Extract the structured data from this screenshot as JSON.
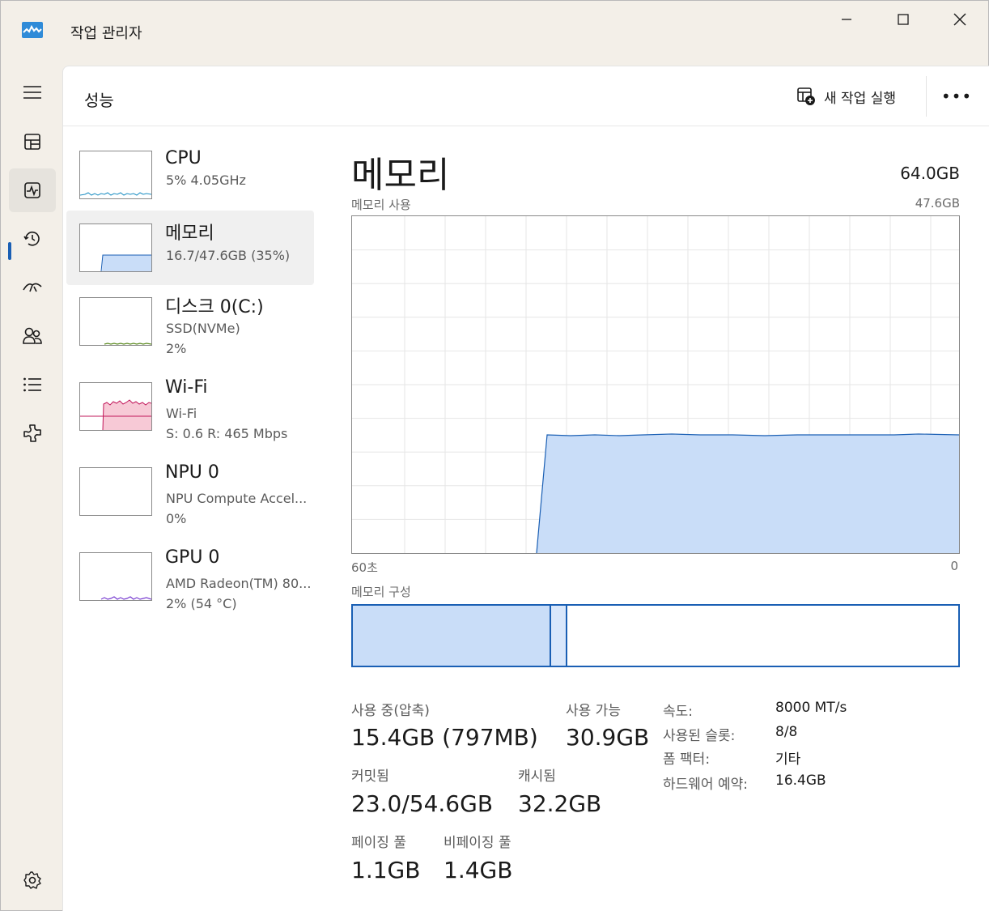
{
  "app": {
    "title": "작업 관리자"
  },
  "header": {
    "title": "성능",
    "run_task_label": "새 작업 실행",
    "more_label": "•••"
  },
  "nav": {
    "items": [
      {
        "icon": "hamburger-menu-icon"
      },
      {
        "icon": "processes-icon"
      },
      {
        "icon": "performance-icon"
      },
      {
        "icon": "app-history-icon"
      },
      {
        "icon": "startup-apps-icon"
      },
      {
        "icon": "users-icon"
      },
      {
        "icon": "details-icon"
      },
      {
        "icon": "services-icon"
      },
      {
        "icon": "settings-icon"
      }
    ]
  },
  "sidebar": {
    "items": [
      {
        "title": "CPU",
        "line1": "5%  4.05GHz",
        "line2": ""
      },
      {
        "title": "메모리",
        "line1": "16.7/47.6GB (35%)",
        "line2": ""
      },
      {
        "title": "디스크 0(C:)",
        "line1": "SSD(NVMe)",
        "line2": "2%"
      },
      {
        "title": "Wi-Fi",
        "line1": "Wi-Fi",
        "line2": "S: 0.6  R: 465 Mbps"
      },
      {
        "title": "NPU 0",
        "line1": "NPU Compute Accel...",
        "line2": "0%"
      },
      {
        "title": "GPU 0",
        "line1": "AMD Radeon(TM) 80...",
        "line2": "2% (54 °C)"
      }
    ]
  },
  "main": {
    "title": "메모리",
    "total": "64.0GB",
    "usage_label": "메모리 사용",
    "usage_max": "47.6GB",
    "axis_left": "60초",
    "axis_right": "0",
    "composition_label": "메모리 구성",
    "stats": {
      "in_use_label": "사용 중(압축)",
      "in_use_value": "15.4GB (797MB)",
      "available_label": "사용 가능",
      "available_value": "30.9GB",
      "committed_label": "커밋됨",
      "committed_value": "23.0/54.6GB",
      "cached_label": "캐시됨",
      "cached_value": "32.2GB",
      "paged_label": "페이징 풀",
      "paged_value": "1.1GB",
      "nonpaged_label": "비페이징 풀",
      "nonpaged_value": "1.4GB"
    },
    "details": {
      "speed_label": "속도:",
      "speed_value": "8000 MT/s",
      "slots_label": "사용된 슬롯:",
      "slots_value": "8/8",
      "form_label": "폼 팩터:",
      "form_value": "기타",
      "reserved_label": "하드웨어 예약:",
      "reserved_value": "16.4GB"
    }
  },
  "colors": {
    "memory_fill": "#c9ddf8",
    "memory_line": "#1a5fb4",
    "wifi_fill": "#f7c9d6",
    "wifi_line": "#c2185b",
    "disk_line": "#5a8a1f",
    "gpu_line": "#7a3fd1",
    "cpu_line": "#1b8ec2"
  }
}
